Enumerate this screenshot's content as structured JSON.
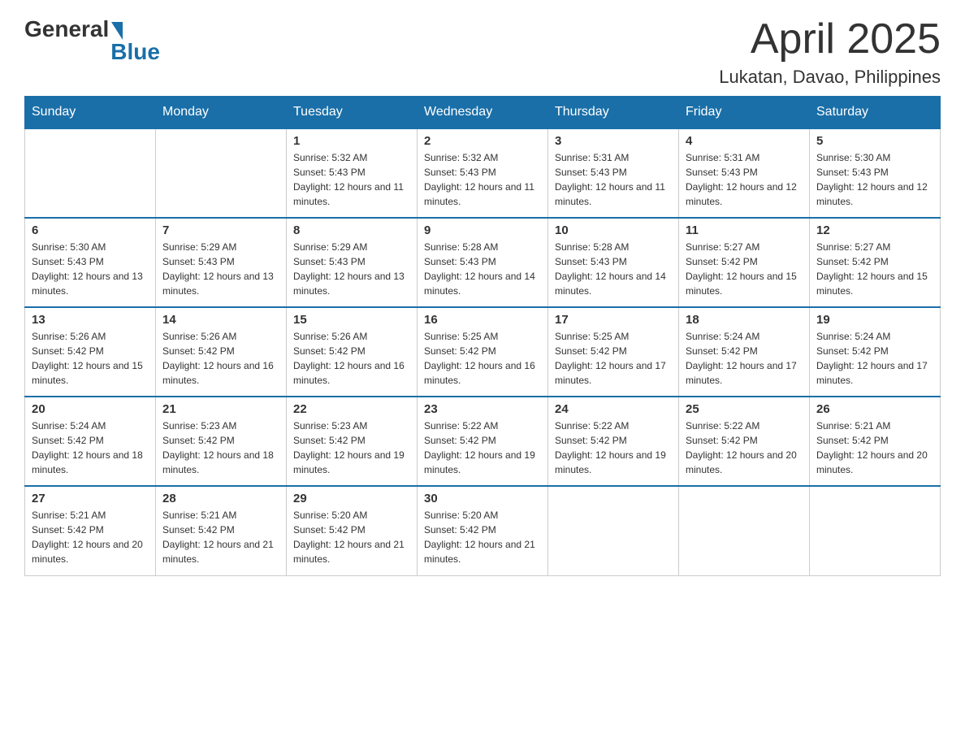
{
  "logo": {
    "general": "General",
    "blue": "Blue"
  },
  "title": "April 2025",
  "location": "Lukatan, Davao, Philippines",
  "weekdays": [
    "Sunday",
    "Monday",
    "Tuesday",
    "Wednesday",
    "Thursday",
    "Friday",
    "Saturday"
  ],
  "weeks": [
    [
      {
        "day": "",
        "sunrise": "",
        "sunset": "",
        "daylight": ""
      },
      {
        "day": "",
        "sunrise": "",
        "sunset": "",
        "daylight": ""
      },
      {
        "day": "1",
        "sunrise": "Sunrise: 5:32 AM",
        "sunset": "Sunset: 5:43 PM",
        "daylight": "Daylight: 12 hours and 11 minutes."
      },
      {
        "day": "2",
        "sunrise": "Sunrise: 5:32 AM",
        "sunset": "Sunset: 5:43 PM",
        "daylight": "Daylight: 12 hours and 11 minutes."
      },
      {
        "day": "3",
        "sunrise": "Sunrise: 5:31 AM",
        "sunset": "Sunset: 5:43 PM",
        "daylight": "Daylight: 12 hours and 11 minutes."
      },
      {
        "day": "4",
        "sunrise": "Sunrise: 5:31 AM",
        "sunset": "Sunset: 5:43 PM",
        "daylight": "Daylight: 12 hours and 12 minutes."
      },
      {
        "day": "5",
        "sunrise": "Sunrise: 5:30 AM",
        "sunset": "Sunset: 5:43 PM",
        "daylight": "Daylight: 12 hours and 12 minutes."
      }
    ],
    [
      {
        "day": "6",
        "sunrise": "Sunrise: 5:30 AM",
        "sunset": "Sunset: 5:43 PM",
        "daylight": "Daylight: 12 hours and 13 minutes."
      },
      {
        "day": "7",
        "sunrise": "Sunrise: 5:29 AM",
        "sunset": "Sunset: 5:43 PM",
        "daylight": "Daylight: 12 hours and 13 minutes."
      },
      {
        "day": "8",
        "sunrise": "Sunrise: 5:29 AM",
        "sunset": "Sunset: 5:43 PM",
        "daylight": "Daylight: 12 hours and 13 minutes."
      },
      {
        "day": "9",
        "sunrise": "Sunrise: 5:28 AM",
        "sunset": "Sunset: 5:43 PM",
        "daylight": "Daylight: 12 hours and 14 minutes."
      },
      {
        "day": "10",
        "sunrise": "Sunrise: 5:28 AM",
        "sunset": "Sunset: 5:43 PM",
        "daylight": "Daylight: 12 hours and 14 minutes."
      },
      {
        "day": "11",
        "sunrise": "Sunrise: 5:27 AM",
        "sunset": "Sunset: 5:42 PM",
        "daylight": "Daylight: 12 hours and 15 minutes."
      },
      {
        "day": "12",
        "sunrise": "Sunrise: 5:27 AM",
        "sunset": "Sunset: 5:42 PM",
        "daylight": "Daylight: 12 hours and 15 minutes."
      }
    ],
    [
      {
        "day": "13",
        "sunrise": "Sunrise: 5:26 AM",
        "sunset": "Sunset: 5:42 PM",
        "daylight": "Daylight: 12 hours and 15 minutes."
      },
      {
        "day": "14",
        "sunrise": "Sunrise: 5:26 AM",
        "sunset": "Sunset: 5:42 PM",
        "daylight": "Daylight: 12 hours and 16 minutes."
      },
      {
        "day": "15",
        "sunrise": "Sunrise: 5:26 AM",
        "sunset": "Sunset: 5:42 PM",
        "daylight": "Daylight: 12 hours and 16 minutes."
      },
      {
        "day": "16",
        "sunrise": "Sunrise: 5:25 AM",
        "sunset": "Sunset: 5:42 PM",
        "daylight": "Daylight: 12 hours and 16 minutes."
      },
      {
        "day": "17",
        "sunrise": "Sunrise: 5:25 AM",
        "sunset": "Sunset: 5:42 PM",
        "daylight": "Daylight: 12 hours and 17 minutes."
      },
      {
        "day": "18",
        "sunrise": "Sunrise: 5:24 AM",
        "sunset": "Sunset: 5:42 PM",
        "daylight": "Daylight: 12 hours and 17 minutes."
      },
      {
        "day": "19",
        "sunrise": "Sunrise: 5:24 AM",
        "sunset": "Sunset: 5:42 PM",
        "daylight": "Daylight: 12 hours and 17 minutes."
      }
    ],
    [
      {
        "day": "20",
        "sunrise": "Sunrise: 5:24 AM",
        "sunset": "Sunset: 5:42 PM",
        "daylight": "Daylight: 12 hours and 18 minutes."
      },
      {
        "day": "21",
        "sunrise": "Sunrise: 5:23 AM",
        "sunset": "Sunset: 5:42 PM",
        "daylight": "Daylight: 12 hours and 18 minutes."
      },
      {
        "day": "22",
        "sunrise": "Sunrise: 5:23 AM",
        "sunset": "Sunset: 5:42 PM",
        "daylight": "Daylight: 12 hours and 19 minutes."
      },
      {
        "day": "23",
        "sunrise": "Sunrise: 5:22 AM",
        "sunset": "Sunset: 5:42 PM",
        "daylight": "Daylight: 12 hours and 19 minutes."
      },
      {
        "day": "24",
        "sunrise": "Sunrise: 5:22 AM",
        "sunset": "Sunset: 5:42 PM",
        "daylight": "Daylight: 12 hours and 19 minutes."
      },
      {
        "day": "25",
        "sunrise": "Sunrise: 5:22 AM",
        "sunset": "Sunset: 5:42 PM",
        "daylight": "Daylight: 12 hours and 20 minutes."
      },
      {
        "day": "26",
        "sunrise": "Sunrise: 5:21 AM",
        "sunset": "Sunset: 5:42 PM",
        "daylight": "Daylight: 12 hours and 20 minutes."
      }
    ],
    [
      {
        "day": "27",
        "sunrise": "Sunrise: 5:21 AM",
        "sunset": "Sunset: 5:42 PM",
        "daylight": "Daylight: 12 hours and 20 minutes."
      },
      {
        "day": "28",
        "sunrise": "Sunrise: 5:21 AM",
        "sunset": "Sunset: 5:42 PM",
        "daylight": "Daylight: 12 hours and 21 minutes."
      },
      {
        "day": "29",
        "sunrise": "Sunrise: 5:20 AM",
        "sunset": "Sunset: 5:42 PM",
        "daylight": "Daylight: 12 hours and 21 minutes."
      },
      {
        "day": "30",
        "sunrise": "Sunrise: 5:20 AM",
        "sunset": "Sunset: 5:42 PM",
        "daylight": "Daylight: 12 hours and 21 minutes."
      },
      {
        "day": "",
        "sunrise": "",
        "sunset": "",
        "daylight": ""
      },
      {
        "day": "",
        "sunrise": "",
        "sunset": "",
        "daylight": ""
      },
      {
        "day": "",
        "sunrise": "",
        "sunset": "",
        "daylight": ""
      }
    ]
  ]
}
